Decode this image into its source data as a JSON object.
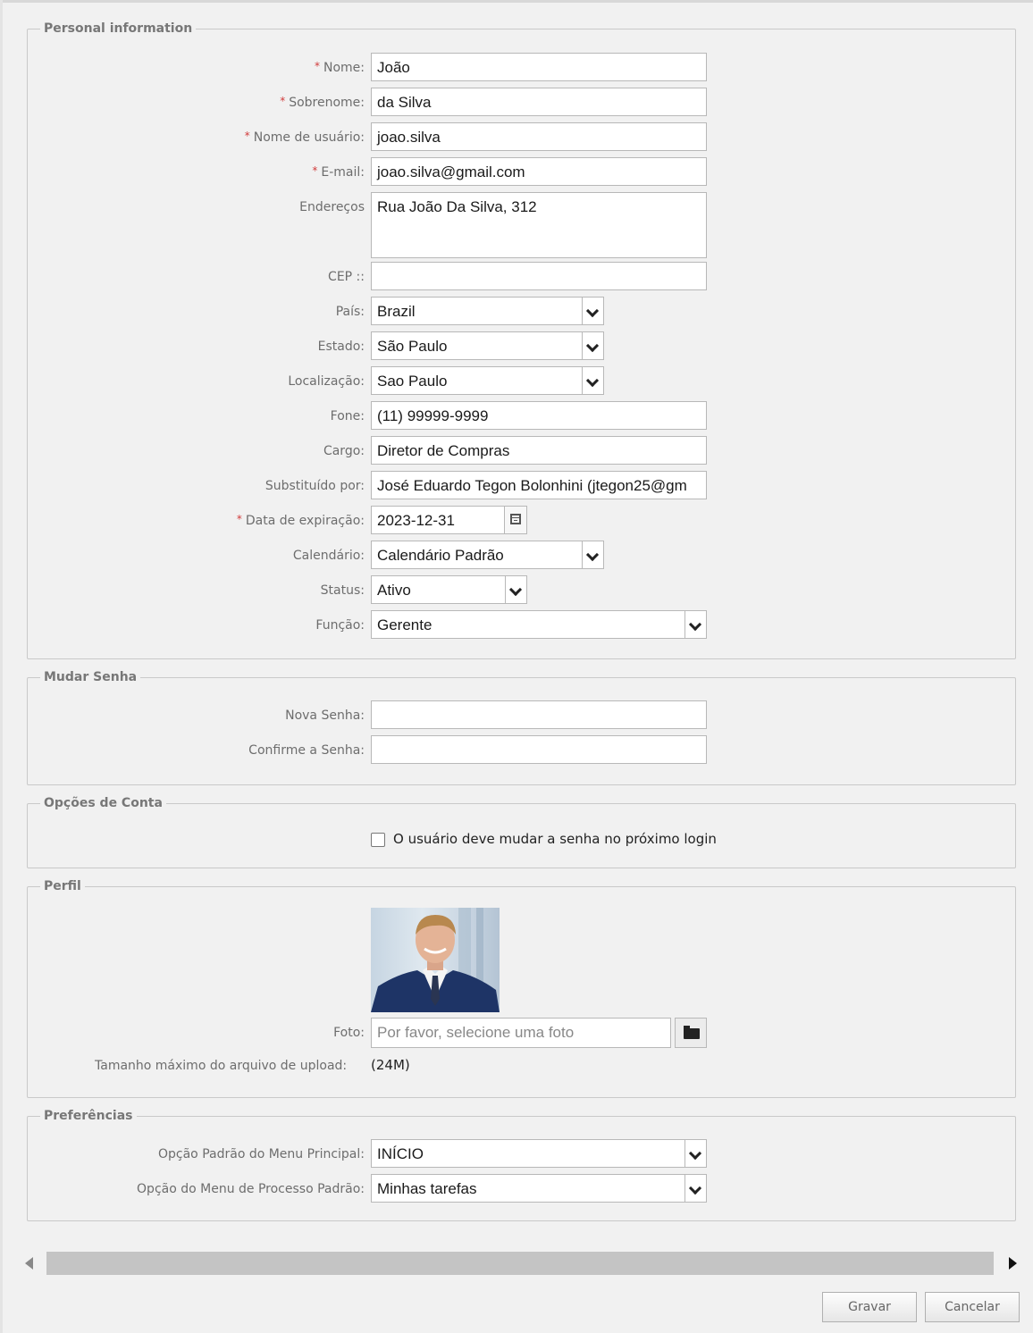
{
  "personal": {
    "legend": "Personal information",
    "nome": {
      "label": "Nome:",
      "value": "João"
    },
    "sobrenome": {
      "label": "Sobrenome:",
      "value": "da Silva"
    },
    "usuario": {
      "label": "Nome de usuário:",
      "value": "joao.silva"
    },
    "email": {
      "label": "E-mail:",
      "value": "joao.silva@gmail.com"
    },
    "enderecos": {
      "label": "Endereços",
      "value": "Rua João Da Silva, 312"
    },
    "cep": {
      "label": "CEP ::",
      "value": ""
    },
    "pais": {
      "label": "País:",
      "value": "Brazil"
    },
    "estado": {
      "label": "Estado:",
      "value": "São Paulo"
    },
    "localizacao": {
      "label": "Localização:",
      "value": "Sao Paulo"
    },
    "fone": {
      "label": "Fone:",
      "value": "(11) 99999-9999"
    },
    "cargo": {
      "label": "Cargo:",
      "value": "Diretor de Compras"
    },
    "substituido": {
      "label": "Substituído por:",
      "value": "José Eduardo Tegon Bolonhini (jtegon25@gm"
    },
    "expiracao": {
      "label": "Data de expiração:",
      "value": "2023-12-31"
    },
    "calendario": {
      "label": "Calendário:",
      "value": "Calendário Padrão"
    },
    "status": {
      "label": "Status:",
      "value": "Ativo"
    },
    "funcao": {
      "label": "Função:",
      "value": "Gerente"
    },
    "required_mark": "*"
  },
  "senha": {
    "legend": "Mudar Senha",
    "nova": {
      "label": "Nova Senha:",
      "value": ""
    },
    "confirme": {
      "label": "Confirme a Senha:",
      "value": ""
    }
  },
  "conta": {
    "legend": "Opções de Conta",
    "must_change_label": "O usuário deve mudar a senha no próximo login",
    "must_change_checked": false
  },
  "perfil": {
    "legend": "Perfil",
    "foto_label": "Foto:",
    "foto_placeholder": "Por favor, selecione uma foto",
    "upload_label": "Tamanho máximo do arquivo de upload:",
    "upload_value": "(24M)"
  },
  "preferencias": {
    "legend": "Preferências",
    "menu_principal": {
      "label": "Opção Padrão do Menu Principal:",
      "value": "INÍCIO"
    },
    "menu_processo": {
      "label": "Opção do Menu de Processo Padrão:",
      "value": "Minhas tarefas"
    }
  },
  "actions": {
    "save": "Gravar",
    "cancel": "Cancelar"
  },
  "icons": {
    "select_arrow": "chevron-down-icon",
    "calendar": "calendar-icon",
    "folder": "folder-icon",
    "scroll_left": "arrow-left-icon",
    "scroll_right": "arrow-right-icon"
  }
}
